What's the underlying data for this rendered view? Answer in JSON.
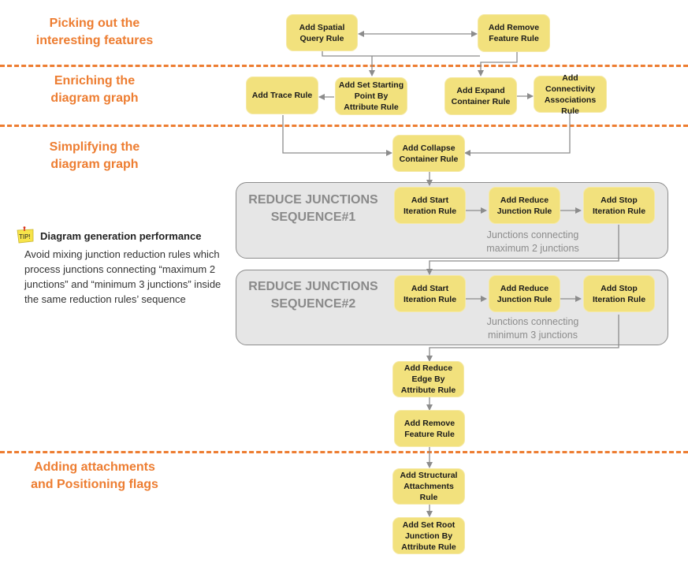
{
  "colors": {
    "accent": "#ED7D31",
    "rule_fill": "#F2E17D",
    "sequence_fill": "#E6E6E6",
    "connector": "#8C8C8C",
    "sequence_title": "#8A8A8A"
  },
  "stages": [
    {
      "label_line1": "Picking out the",
      "label_line2": "interesting features"
    },
    {
      "label_line1": "Enriching the",
      "label_line2": "diagram graph"
    },
    {
      "label_line1": "Simplifying the",
      "label_line2": "diagram graph"
    },
    {
      "label_line1": "Adding attachments",
      "label_line2": "and Positioning flags"
    }
  ],
  "rules": {
    "spatial_query": "Add Spatial Query Rule",
    "remove_feature_1": "Add Remove Feature Rule",
    "trace": "Add Trace Rule",
    "set_starting_point": "Add Set  Starting Point By Attribute Rule",
    "expand_container": "Add Expand Container Rule",
    "connectivity_associations": "Add Connectivity Associations Rule",
    "collapse_container": "Add Collapse Container Rule",
    "seq1_start": "Add Start Iteration Rule",
    "seq1_reduce": "Add Reduce Junction Rule",
    "seq1_stop": "Add Stop Iteration Rule",
    "seq2_start": "Add Start Iteration Rule",
    "seq2_reduce": "Add Reduce Junction Rule",
    "seq2_stop": "Add Stop Iteration Rule",
    "reduce_edge": "Add Reduce Edge By Attribute Rule",
    "remove_feature_2": "Add Remove Feature Rule",
    "structural_attachments": "Add Structural Attachments Rule",
    "set_root_junction": "Add Set Root Junction By Attribute Rule"
  },
  "sequences": [
    {
      "title_line1": "REDUCE JUNCTIONS",
      "title_line2": "SEQUENCE#1",
      "note_line1": "Junctions connecting",
      "note_line2": "maximum 2 junctions"
    },
    {
      "title_line1": "REDUCE JUNCTIONS",
      "title_line2": "SEQUENCE#2",
      "note_line1": "Junctions connecting",
      "note_line2": "minimum 3 junctions"
    }
  ],
  "tip": {
    "icon": "tip-sticky-note-icon",
    "icon_text": "TIP!",
    "title": "Diagram generation performance",
    "body": "Avoid mixing junction reduction rules which process junctions connecting “maximum 2 junctions” and “minimum 3 junctions” inside the same reduction rules’ sequence"
  }
}
